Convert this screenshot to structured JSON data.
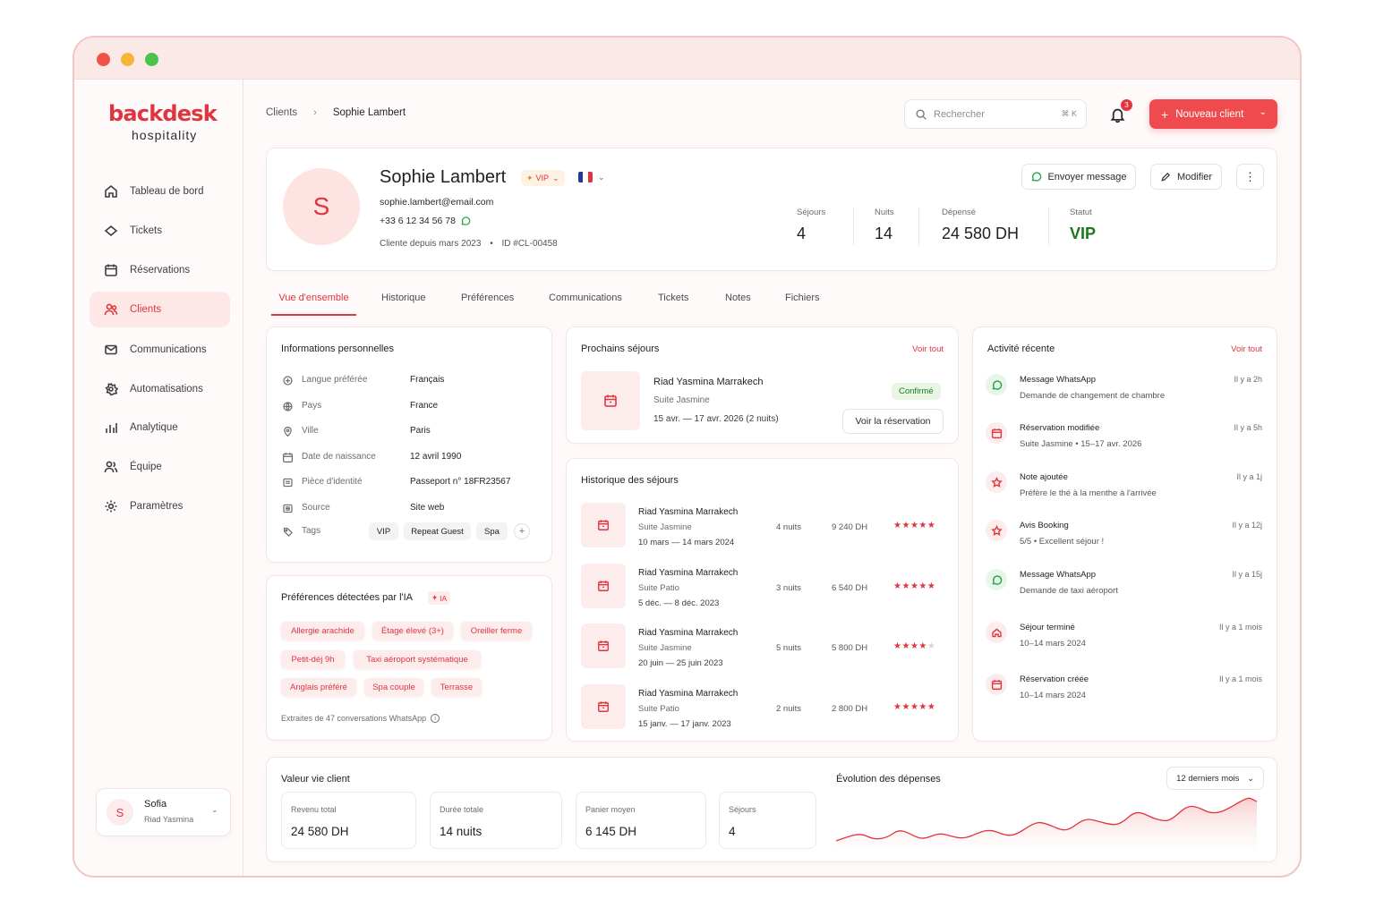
{
  "brand": {
    "logo": "backdesk",
    "sub": "hospitality"
  },
  "sidebar": {
    "items": [
      {
        "label": "Tableau de bord",
        "icon": "home-icon"
      },
      {
        "label": "Tickets",
        "icon": "ticket-icon"
      },
      {
        "label": "Réservations",
        "icon": "calendar-icon"
      },
      {
        "label": "Clients",
        "icon": "users-icon",
        "active": true
      },
      {
        "label": "Communications",
        "icon": "mail-icon"
      },
      {
        "label": "Automatisations",
        "icon": "automation-icon"
      },
      {
        "label": "Analytique",
        "icon": "analytics-icon"
      },
      {
        "label": "Équipe",
        "icon": "team-icon"
      },
      {
        "label": "Paramètres",
        "icon": "settings-icon"
      }
    ],
    "user": {
      "initial": "S",
      "name": "Sofia",
      "property": "Riad Yasmina"
    }
  },
  "header": {
    "breadcrumb": [
      "Clients",
      "Sophie Lambert"
    ],
    "search_placeholder": "Rechercher",
    "search_shortcut": "⌘ K",
    "notif_count": "3",
    "new_client_label": "Nouveau client"
  },
  "profile": {
    "initial": "S",
    "name": "Sophie Lambert",
    "vip_badge": "VIP",
    "email": "sophie.lambert@email.com",
    "phone": "+33 6 12 34 56 78",
    "since": "Cliente depuis mars 2023",
    "id": "ID #CL-00458",
    "send_message": "Envoyer message",
    "edit": "Modifier",
    "stats": [
      {
        "label": "Séjours",
        "value": "4"
      },
      {
        "label": "Nuits",
        "value": "14"
      },
      {
        "label": "Dépensé",
        "value": "24 580 DH"
      },
      {
        "label": "Statut",
        "value": "VIP"
      }
    ]
  },
  "tabs": [
    "Vue d'ensemble",
    "Historique",
    "Préférences",
    "Communications",
    "Tickets",
    "Notes",
    "Fichiers"
  ],
  "personal": {
    "title": "Informations personnelles",
    "rows": [
      {
        "label": "Langue préférée",
        "value": "Français",
        "icon": "language-icon"
      },
      {
        "label": "Pays",
        "value": "France",
        "icon": "globe-icon"
      },
      {
        "label": "Ville",
        "value": "Paris",
        "icon": "pin-icon"
      },
      {
        "label": "Date de naissance",
        "value": "12 avril 1990",
        "icon": "calendar-icon"
      },
      {
        "label": "Pièce d'identité",
        "value": "Passeport n° 18FR23567",
        "icon": "id-card-icon"
      },
      {
        "label": "Source",
        "value": "Site web",
        "icon": "source-icon"
      }
    ],
    "tags_label": "Tags",
    "tags": [
      "VIP",
      "Repeat Guest",
      "Spa"
    ],
    "add_tag": "+"
  },
  "ai_prefs": {
    "title": "Préférences détectées par l'IA",
    "badge": "IA",
    "chips": [
      "Allergie arachide",
      "Étage élevé (3+)",
      "Oreiller ferme",
      "Petit-déj 9h",
      "Taxi aéroport systématique",
      "Anglais préféré",
      "Spa couple",
      "Terrasse"
    ],
    "footer": "Extraites de 47 conversations WhatsApp"
  },
  "upcoming": {
    "title": "Prochains séjours",
    "see_all": "Voir tout",
    "hotel": "Riad Yasmina Marrakech",
    "room": "Suite Jasmine",
    "dates": "15 avr. — 17 avr. 2026 (2 nuits)",
    "status": "Confirmé",
    "view": "Voir la réservation"
  },
  "history": {
    "title": "Historique des séjours",
    "rows": [
      {
        "hotel": "Riad Yasmina Marrakech",
        "room": "Suite Jasmine",
        "dates": "10 mars — 14 mars 2024",
        "nights": "4 nuits",
        "amount": "9 240 DH",
        "rating": 5
      },
      {
        "hotel": "Riad Yasmina Marrakech",
        "room": "Suite Patio",
        "dates": "5 déc. — 8 déc. 2023",
        "nights": "3 nuits",
        "amount": "6 540 DH",
        "rating": 5
      },
      {
        "hotel": "Riad Yasmina Marrakech",
        "room": "Suite Jasmine",
        "dates": "20 juin — 25 juin 2023",
        "nights": "5 nuits",
        "amount": "5 800 DH",
        "rating": 4
      },
      {
        "hotel": "Riad Yasmina Marrakech",
        "room": "Suite Patio",
        "dates": "15 janv. — 17 janv. 2023",
        "nights": "2 nuits",
        "amount": "2 800 DH",
        "rating": 5
      }
    ]
  },
  "activity": {
    "title": "Activité récente",
    "see_all": "Voir tout",
    "items": [
      {
        "title": "Message WhatsApp",
        "desc": "Demande de changement de chambre",
        "time": "Il y a 2h",
        "icon": "whatsapp-icon"
      },
      {
        "title": "Réservation modifiée",
        "desc": "Suite Jasmine • 15–17 avr. 2026",
        "time": "Il y a 5h",
        "icon": "calendar-icon"
      },
      {
        "title": "Note ajoutée",
        "desc": "Préfère le thé à la menthe à l'arrivée",
        "time": "Il y a 1j",
        "icon": "star-icon"
      },
      {
        "title": "Avis Booking",
        "desc": "5/5 • Excellent séjour !",
        "time": "Il y a 12j",
        "icon": "star-icon"
      },
      {
        "title": "Message WhatsApp",
        "desc": "Demande de taxi aéroport",
        "time": "Il y a 15j",
        "icon": "whatsapp-icon"
      },
      {
        "title": "Séjour terminé",
        "desc": "10–14 mars 2024",
        "time": "Il y a 1 mois",
        "icon": "home-icon"
      },
      {
        "title": "Réservation créée",
        "desc": "10–14 mars 2024",
        "time": "Il y a 1 mois",
        "icon": "calendar-icon"
      }
    ]
  },
  "lifetime": {
    "title": "Valeur vie client",
    "stats": [
      {
        "label": "Revenu total",
        "value": "24 580 DH"
      },
      {
        "label": "Durée totale",
        "value": "14 nuits"
      },
      {
        "label": "Panier moyen",
        "value": "6 145 DH"
      },
      {
        "label": "Séjours",
        "value": "4"
      }
    ]
  },
  "spending": {
    "title": "Évolution des dépenses",
    "period": "12 derniers mois"
  },
  "colors": {
    "accent": "#e0353f",
    "accent_light": "#fdecec",
    "vip_green": "#1a7a1a",
    "whatsapp": "#25a244"
  }
}
